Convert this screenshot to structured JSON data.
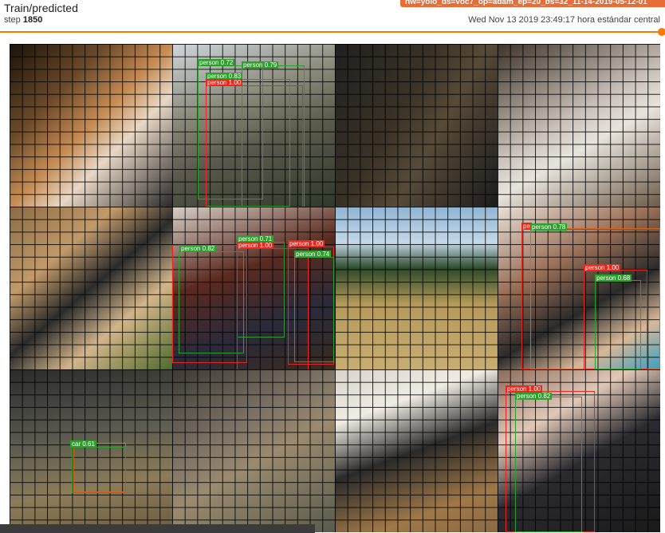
{
  "header": {
    "title": "Train/predicted",
    "step_label": "step",
    "step_value": "1850",
    "run_name": "nw=yolo_ds=voc7_op=adam_ep=20_bs=32_11-14-2019-05-12-01",
    "timestamp": "Wed Nov 13 2019 23:49:17 hora estándar central"
  },
  "colors": {
    "accent": "#f57c00",
    "run_tag": "#e96b35",
    "box_red": "#e8271f",
    "box_green": "#2da02c"
  },
  "tiles": [
    {
      "name": "cat",
      "bg": "linear-gradient(135deg,#1a1208 0%,#6b4a2a 30%,#c58b52 50%,#e8d7c5 65%,#2a2a2a 100%)",
      "labels": []
    },
    {
      "name": "people-bench",
      "bg": "linear-gradient(160deg,#cfd6dc 0%,#8c8c7c 35%,#5b5a4c 60%,#2f3a2a 100%)",
      "labels": [
        {
          "text": "person 0.72",
          "color": "green"
        },
        {
          "text": "person 0.79",
          "color": "green"
        },
        {
          "text": "person 0.83",
          "color": "green"
        },
        {
          "text": "person 1.00",
          "color": "red"
        }
      ]
    },
    {
      "name": "train-interior",
      "bg": "linear-gradient(120deg,#202020 0%,#3a3226 40%,#574a38 60%,#1c1c1c 100%)",
      "labels": []
    },
    {
      "name": "alpaca",
      "bg": "linear-gradient(150deg,#3c3228 0%,#c8c0b8 45%,#e8e4dc 60%,#6d5b4a 100%)",
      "labels": []
    },
    {
      "name": "ram",
      "bg": "linear-gradient(140deg,#8a6a44 0%,#c29a6a 30%,#2b2b2b 50%,#d2b58a 70%,#4f6a2c 100%)",
      "labels": []
    },
    {
      "name": "people-couch",
      "bg": "linear-gradient(160deg,#d8d0c8 0%,#5a2a20 40%,#2a2a3a 70%,#3a2a20 100%)",
      "labels": [
        {
          "text": "person 0.82",
          "color": "green"
        },
        {
          "text": "person 0.71",
          "color": "green"
        },
        {
          "text": "person 1.00",
          "color": "red"
        },
        {
          "text": "person 1.00",
          "color": "red"
        },
        {
          "text": "person 0.74",
          "color": "green"
        }
      ]
    },
    {
      "name": "hillside-train",
      "bg": "linear-gradient(180deg,#8fb4d4 0%,#c4d8e8 22%,#2d4a2a 38%,#b59a5a 60%,#c8ad72 100%)",
      "labels": []
    },
    {
      "name": "boy-child",
      "bg": "linear-gradient(150deg,#e8e0d8 0%,#9a7058 35%,#2a2a2a 60%,#d8b898 80%,#3aa0c0 100%)",
      "labels": [
        {
          "text": "pe",
          "color": "red"
        },
        {
          "text": "person 0.78",
          "color": "green"
        },
        {
          "text": "person 1.00",
          "color": "red"
        },
        {
          "text": "person 0.68",
          "color": "green"
        }
      ]
    },
    {
      "name": "toy-car",
      "bg": "linear-gradient(170deg,#2a2a2a 0%,#5a5a50 40%,#8c7c5a 70%,#6a5c40 100%)",
      "labels": [
        {
          "text": "car 0.61",
          "color": "green"
        }
      ]
    },
    {
      "name": "bird",
      "bg": "linear-gradient(150deg,#3c3a34 0%,#7a7064 35%,#9a8a70 55%,#5a5a4c 100%)",
      "labels": []
    },
    {
      "name": "computer-desk",
      "bg": "linear-gradient(160deg,#d8d4cc 0%,#f0ece4 25%,#2a2a2a 50%,#a07848 80%,#8a6a44 100%)",
      "labels": []
    },
    {
      "name": "people-cow",
      "bg": "linear-gradient(150deg,#8a6a5a 0%,#e0c8b8 30%,#2a2a30 55%,#1a1a1a 100%)",
      "labels": [
        {
          "text": "person 1.00",
          "color": "red"
        },
        {
          "text": "person 0.82",
          "color": "green"
        }
      ]
    }
  ]
}
